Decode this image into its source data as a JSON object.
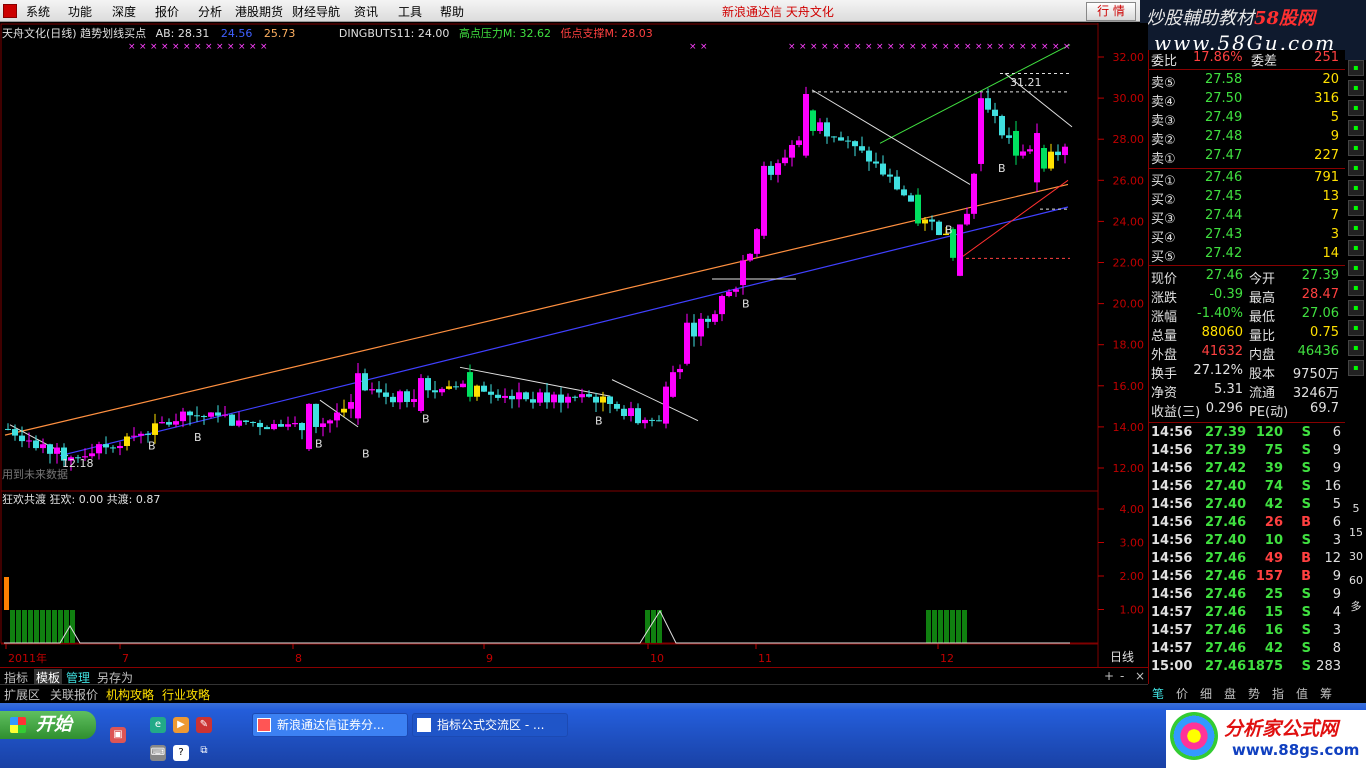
{
  "menu": {
    "items": [
      "系统",
      "功能",
      "深度",
      "报价",
      "分析",
      "港股期货",
      "财经导航",
      "资讯",
      "工具",
      "帮助"
    ],
    "title": "新浪通达信  天舟文化",
    "trade_button": "行 情"
  },
  "watermark_top": {
    "line1": "炒股輔助教材",
    "line1_red": "58股网",
    "line2": "www.58Gu.com"
  },
  "chart": {
    "legend": {
      "prefix": "天舟文化(日线) 趋势划线买点",
      "ab_label": "AB: 28.31",
      "blue_value": "24.56",
      "yellow_value": "25.73",
      "dingbuts": "DINGBUTS11: 24.00",
      "high_pressure": "高点压力M: 32.62",
      "low_support": "低点支撑M: 28.03"
    },
    "lower_legend": "狂欢共渡  狂欢: 0.00  共渡: 0.87",
    "bottom_left_text": "用到未来数据",
    "annotation_high": "31.21",
    "annotation_low": "12.18",
    "price_axis": [
      "32.00",
      "30.00",
      "28.00",
      "26.00",
      "24.00",
      "22.00",
      "20.00",
      "18.00",
      "16.00",
      "14.00",
      "12.00"
    ],
    "lower_axis": [
      "4.00",
      "3.00",
      "2.00",
      "1.00"
    ],
    "date_axis": [
      "2011年",
      "7",
      "8",
      "9",
      "10",
      "11",
      "12"
    ],
    "period_label": "日线",
    "b_marker": "B",
    "colors": {
      "up": "#ff00ff",
      "down": "#40e0e0",
      "mid": "#00e060",
      "flat": "#ffe000"
    }
  },
  "quote": {
    "header": {
      "label1": "委比",
      "value1": "17.86%",
      "label2": "委差",
      "value2": "251"
    },
    "sells": [
      {
        "label": "卖⑤",
        "price": "27.58",
        "vol": "20"
      },
      {
        "label": "卖④",
        "price": "27.50",
        "vol": "316"
      },
      {
        "label": "卖③",
        "price": "27.49",
        "vol": "5"
      },
      {
        "label": "卖②",
        "price": "27.48",
        "vol": "9"
      },
      {
        "label": "卖①",
        "price": "27.47",
        "vol": "227"
      }
    ],
    "buys": [
      {
        "label": "买①",
        "price": "27.46",
        "vol": "791"
      },
      {
        "label": "买②",
        "price": "27.45",
        "vol": "13"
      },
      {
        "label": "买③",
        "price": "27.44",
        "vol": "7"
      },
      {
        "label": "买④",
        "price": "27.43",
        "vol": "3"
      },
      {
        "label": "买⑤",
        "price": "27.42",
        "vol": "14"
      }
    ],
    "stats": [
      {
        "l1": "现价",
        "v1": "27.46",
        "l2": "今开",
        "v2": "27.39",
        "c1": "#40e040",
        "c2": "#40e040"
      },
      {
        "l1": "涨跌",
        "v1": "-0.39",
        "l2": "最高",
        "v2": "28.47",
        "c1": "#40e040",
        "c2": "#ff4040"
      },
      {
        "l1": "涨幅",
        "v1": "-1.40%",
        "l2": "最低",
        "v2": "27.06",
        "c1": "#40e040",
        "c2": "#40e040"
      },
      {
        "l1": "总量",
        "v1": "88060",
        "l2": "量比",
        "v2": "0.75",
        "c1": "#ffe000",
        "c2": "#ffe000"
      },
      {
        "l1": "外盘",
        "v1": "41632",
        "l2": "内盘",
        "v2": "46436",
        "c1": "#ff4040",
        "c2": "#40e040"
      },
      {
        "l1": "换手",
        "v1": "27.12%",
        "l2": "股本",
        "v2": "9750万",
        "c1": "#e0e0e0",
        "c2": "#e0e0e0"
      },
      {
        "l1": "净资",
        "v1": "5.31",
        "l2": "流通",
        "v2": "3246万",
        "c1": "#e0e0e0",
        "c2": "#e0e0e0"
      },
      {
        "l1": "收益(三)",
        "v1": "0.296",
        "l2": "PE(动)",
        "v2": "69.7",
        "c1": "#e0e0e0",
        "c2": "#e0e0e0"
      }
    ],
    "ticks": [
      {
        "t": "14:56",
        "p": "27.39",
        "v": "120",
        "s": "S",
        "n": "6"
      },
      {
        "t": "14:56",
        "p": "27.39",
        "v": "75",
        "s": "S",
        "n": "9"
      },
      {
        "t": "14:56",
        "p": "27.42",
        "v": "39",
        "s": "S",
        "n": "9"
      },
      {
        "t": "14:56",
        "p": "27.40",
        "v": "74",
        "s": "S",
        "n": "16"
      },
      {
        "t": "14:56",
        "p": "27.40",
        "v": "42",
        "s": "S",
        "n": "5"
      },
      {
        "t": "14:56",
        "p": "27.46",
        "v": "26",
        "s": "B",
        "n": "6"
      },
      {
        "t": "14:56",
        "p": "27.40",
        "v": "10",
        "s": "S",
        "n": "3"
      },
      {
        "t": "14:56",
        "p": "27.46",
        "v": "49",
        "s": "B",
        "n": "12"
      },
      {
        "t": "14:56",
        "p": "27.46",
        "v": "157",
        "s": "B",
        "n": "9"
      },
      {
        "t": "14:56",
        "p": "27.46",
        "v": "25",
        "s": "S",
        "n": "9"
      },
      {
        "t": "14:57",
        "p": "27.46",
        "v": "15",
        "s": "S",
        "n": "4"
      },
      {
        "t": "14:57",
        "p": "27.46",
        "v": "16",
        "s": "S",
        "n": "3"
      },
      {
        "t": "14:57",
        "p": "27.46",
        "v": "42",
        "s": "S",
        "n": "8"
      },
      {
        "t": "15:00",
        "p": "27.46",
        "v": "1875",
        "s": "S",
        "n": "283"
      }
    ]
  },
  "side_labels": [
    "5",
    "15",
    "30",
    "60",
    "多"
  ],
  "tabs_row1": [
    "指标",
    "模板",
    "管理",
    "另存为"
  ],
  "tabs_row2": [
    "扩展区",
    "关联报价",
    "机构攻略",
    "行业攻略"
  ],
  "right_tabs": [
    "笔",
    "价",
    "细",
    "盘",
    "势",
    "指",
    "值",
    "筹"
  ],
  "taskbar": {
    "start": "开始",
    "tasks": [
      "新浪通达信证券分...",
      "指标公式交流区 - ..."
    ]
  },
  "watermark_bottom": {
    "title": "分析家公式网",
    "url": "www.88gs.com"
  }
}
